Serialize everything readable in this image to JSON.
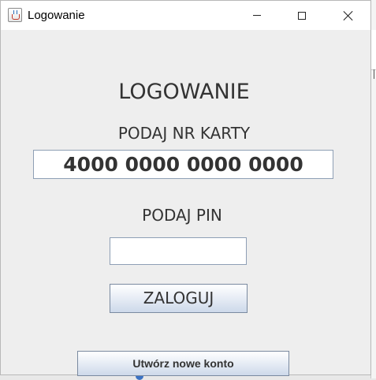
{
  "window": {
    "title": "Logowanie"
  },
  "form": {
    "heading": "LOGOWANIE",
    "card_label": "PODAJ NR KARTY",
    "card_value": "4000 0000 0000 0000",
    "pin_label": "PODAJ PIN",
    "pin_value": "",
    "login_label": "ZALOGUJ",
    "create_account_label": "Utwórz nowe konto"
  },
  "colors": {
    "window_bg": "#eeeeee",
    "titlebar_bg": "#ffffff",
    "text": "#333333",
    "field_border": "#8e9fb5"
  },
  "icons": {
    "app": "java-cup-icon",
    "minimize": "minimize-icon",
    "maximize": "maximize-icon",
    "close": "close-icon"
  }
}
